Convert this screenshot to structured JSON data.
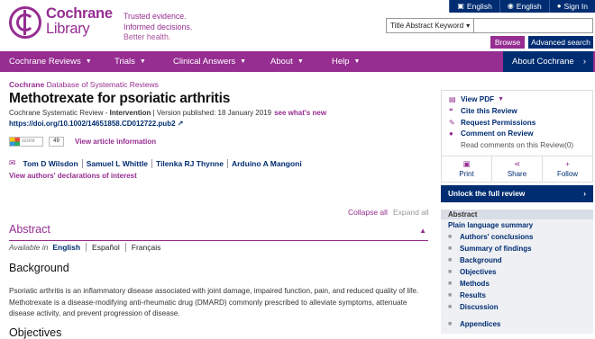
{
  "utility": {
    "english1": "English",
    "english2": "English",
    "signin": "Sign In"
  },
  "brand": {
    "line1": "Cochrane",
    "line2": "Library",
    "tagline": [
      "Trusted evidence.",
      "Informed decisions.",
      "Better health."
    ]
  },
  "search": {
    "select": "Title Abstract Keyword",
    "placeholder": "",
    "browse": "Browse",
    "advanced": "Advanced search"
  },
  "nav": {
    "items": [
      "Cochrane Reviews",
      "Trials",
      "Clinical Answers",
      "About",
      "Help"
    ],
    "about": "About Cochrane"
  },
  "article": {
    "db_prefix": "Cochrane",
    "db_rest": "Database of Systematic Reviews",
    "title": "Methotrexate for psoriatic arthritis",
    "meta": "Cochrane Systematic Review - ",
    "meta_type": "Intervention",
    "meta_version": " | Version published: 18 January 2019",
    "whats_new": "see what's new",
    "doi": "https://doi.org/10.1002/14651858.CD012722.pub2",
    "altmetric_score": "49",
    "altmetric_label": "View article information",
    "authors": [
      "Tom D Wilsdon",
      "Samuel L Whittle",
      "Tilenka RJ Thynne",
      "Arduino A Mangoni"
    ],
    "declarations": "View authors' declarations of interest"
  },
  "controls": {
    "collapse": "Collapse all",
    "expand": "Expand all"
  },
  "abstract": {
    "heading": "Abstract",
    "available_in": "Available in",
    "languages": [
      "English",
      "Español",
      "Français"
    ],
    "background_h": "Background",
    "background_p": "Psoriatic arthritis is an inflammatory disease associated with joint damage, impaired function, pain, and reduced quality of life. Methotrexate is a disease-modifying anti-rheumatic drug (DMARD) commonly prescribed to alleviate symptoms, attenuate disease activity, and prevent progression of disease.",
    "objectives_h": "Objectives"
  },
  "sidebar": {
    "view_pdf": "View PDF",
    "cite": "Cite this Review",
    "permissions": "Request Permissions",
    "comment": "Comment on Review",
    "read_comments": "Read comments on this Review(0)",
    "print": "Print",
    "share": "Share",
    "follow": "Follow",
    "unlock": "Unlock the full review",
    "toc_head": "Abstract",
    "toc_items": [
      "Plain language summary",
      "Authors' conclusions",
      "Summary of findings",
      "Background",
      "Objectives",
      "Methods",
      "Results",
      "Discussion",
      "Appendices"
    ]
  },
  "colors": {
    "purple": "#962d91",
    "navy": "#002d72"
  }
}
